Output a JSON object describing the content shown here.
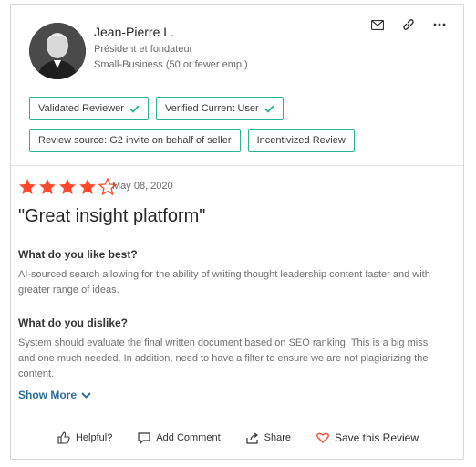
{
  "reviewer": {
    "name": "Jean-Pierre L.",
    "title": "Président et fondateur",
    "company_size": "Small-Business (50 or fewer emp.)"
  },
  "icons": {
    "email": "mail-icon",
    "link": "link-icon",
    "more": "more-horizontal-icon"
  },
  "badges": {
    "row1": [
      {
        "label": "Validated Reviewer",
        "check": true
      },
      {
        "label": "Verified Current User",
        "check": true
      }
    ],
    "row2": [
      {
        "label": "Review source: G2 invite on behalf of seller",
        "check": false
      },
      {
        "label": "Incentivized Review",
        "check": false
      }
    ]
  },
  "review": {
    "rating": 4,
    "max_rating": 5,
    "date": "May 08, 2020",
    "title": "\"Great insight platform\"",
    "like_question": "What do you like best?",
    "like_answer": "AI-sourced search allowing for the ability of writing thought leadership content faster and with greater range of ideas.",
    "dislike_question": "What do you dislike?",
    "dislike_answer": "System should evaluate the final written document based on SEO ranking. This is a big miss and one much needed. In addition, need to have a filter to ensure we are not plagiarizing the content.",
    "show_more": "Show More"
  },
  "footer": {
    "helpful": "Helpful?",
    "add_comment": "Add Comment",
    "share": "Share",
    "save": "Save this Review"
  },
  "colors": {
    "badge_border": "#2bb39a",
    "star": "#ff492c",
    "link": "#2f6f9a",
    "heart": "#ff492c"
  }
}
